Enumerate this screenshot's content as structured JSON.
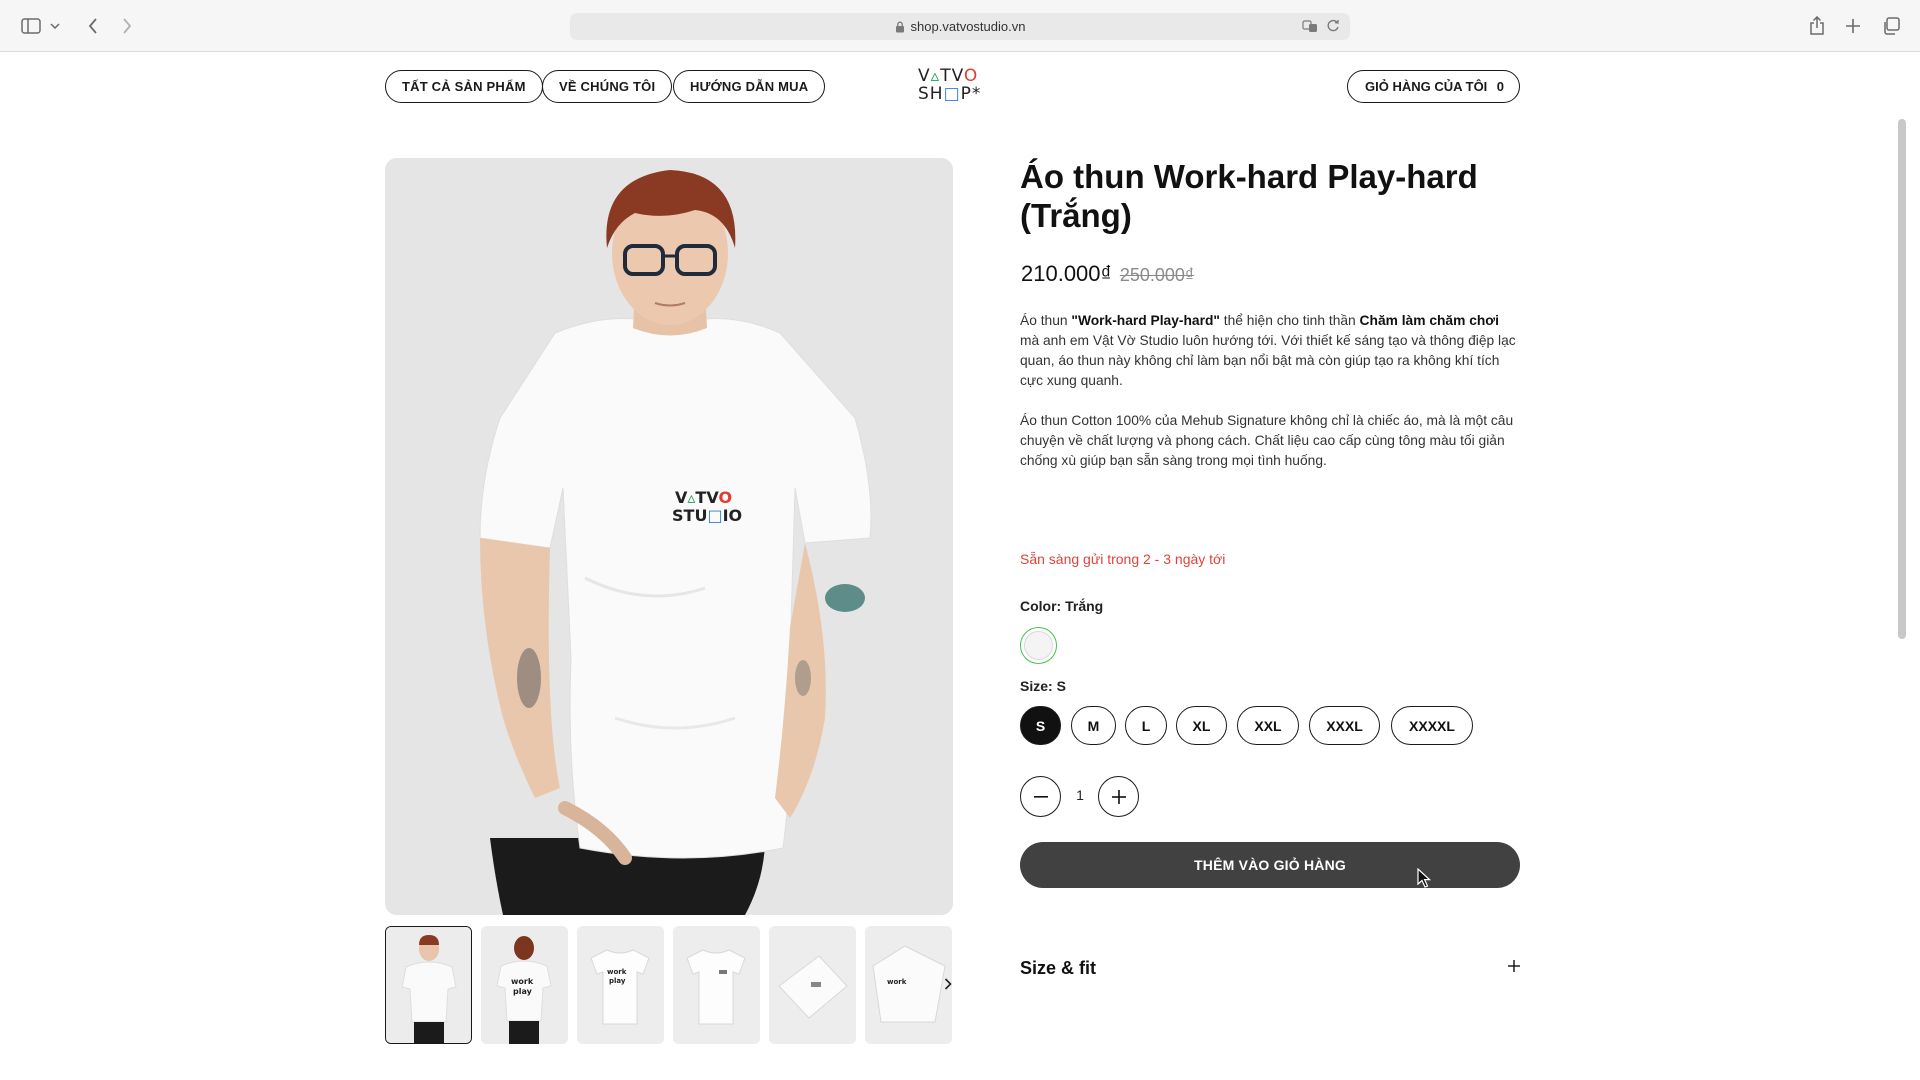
{
  "browser": {
    "url": "shop.vatvostudio.vn"
  },
  "header": {
    "nav": [
      {
        "label": "TẤT CẢ SẢN PHẨM"
      },
      {
        "label": "VỀ CHÚNG TÔI"
      },
      {
        "label": "HƯỚNG DẪN MUA"
      }
    ],
    "logo": {
      "line1": "VATVO",
      "line2": "SHOP*"
    },
    "cart": {
      "label": "GIỎ HÀNG CỦA TÔI",
      "count": "0"
    }
  },
  "gallery": {
    "thumbnail_count": 6,
    "active_index": 0
  },
  "product": {
    "title": "Áo thun Work-hard Play-hard (Trắng)",
    "price": "210.000₫",
    "old_price": "250.000₫",
    "desc1": {
      "t1": "Áo thun ",
      "b1": "\"Work-hard Play-hard\"",
      "t2": " thể hiện cho tinh thần ",
      "b2": "Chăm làm chăm chơi",
      "t3": " mà anh em Vật Vờ Studio luôn hướng tới. Với thiết kế sáng tạo và thông điệp lạc quan, áo thun này không chỉ làm bạn nổi bật mà còn giúp tạo ra không khí tích cực xung quanh."
    },
    "desc2": "Áo thun Cotton 100% của Mehub Signature không chỉ là chiếc áo, mà là một câu chuyện về chất lượng và phong cách. Chất liệu cao cấp cùng tông màu tối giản chống xù giúp bạn sẵn sàng trong mọi tình huống.",
    "shipping": "Sẵn sàng gửi trong 2 - 3 ngày tới",
    "color_label": "Color: Trắng",
    "size_label": "Size: S",
    "sizes": [
      "S",
      "M",
      "L",
      "XL",
      "XXL",
      "XXXL",
      "XXXXL"
    ],
    "selected_size": "S",
    "quantity": "1",
    "add_to_cart": "THÊM VÀO GIỎ HÀNG",
    "accordion_title": "Size & fit"
  },
  "colors": {
    "accent_dark": "#414141",
    "shipping_red": "#e0433a",
    "swatch_ring": "#48c24b"
  }
}
